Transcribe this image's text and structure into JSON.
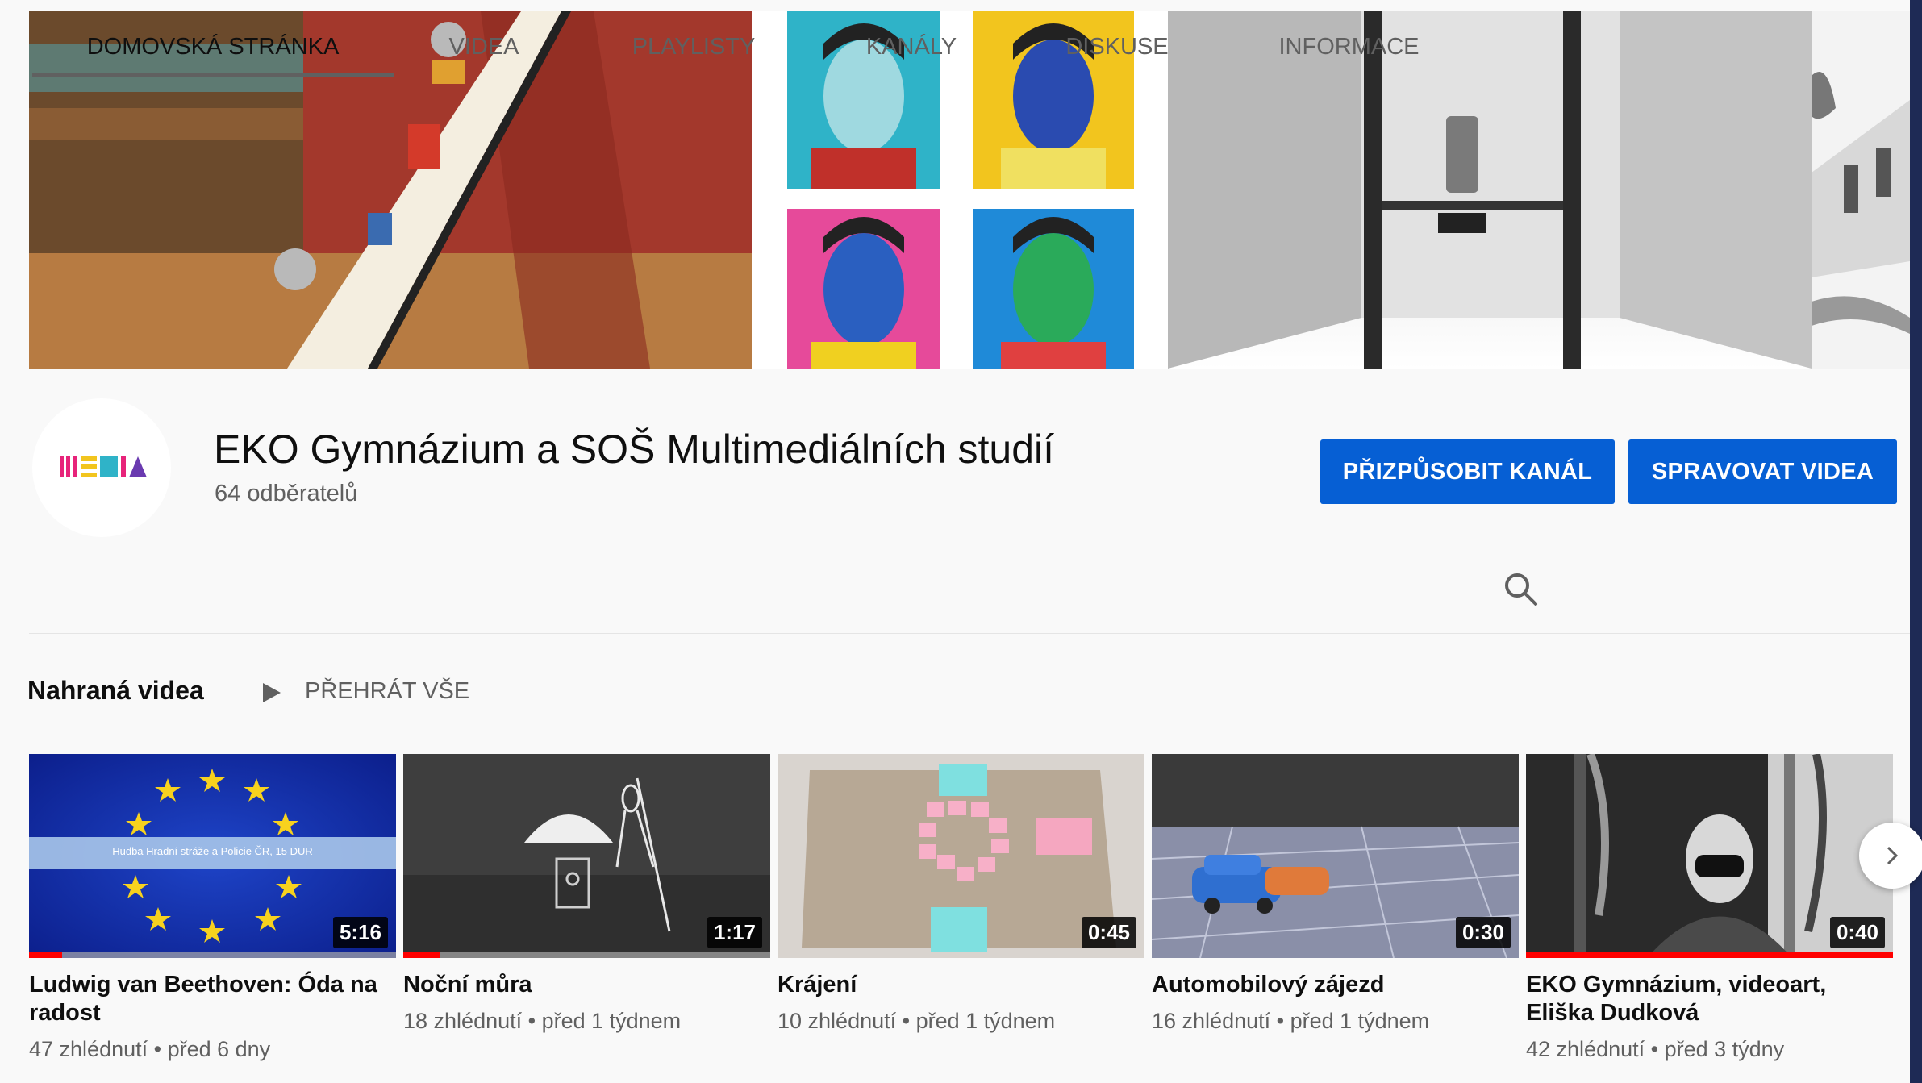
{
  "channel": {
    "name": "EKO Gymnázium a SOŠ Multimediálních studií",
    "subscribers": "64 odběratelů"
  },
  "buttons": {
    "customize": "PŘIZPŮSOBIT KANÁL",
    "manage": "SPRAVOVAT VIDEA"
  },
  "tabs": [
    {
      "label": "DOMOVSKÁ STRÁNKA",
      "active": true
    },
    {
      "label": "VIDEA",
      "active": false
    },
    {
      "label": "PLAYLISTY",
      "active": false
    },
    {
      "label": "KANÁLY",
      "active": false
    },
    {
      "label": "DISKUSE",
      "active": false
    },
    {
      "label": "INFORMACE",
      "active": false
    }
  ],
  "section": {
    "title": "Nahraná videa",
    "play_all": "PŘEHRÁT VŠE"
  },
  "videos": [
    {
      "title": "Ludwig van Beethoven: Óda na radost",
      "duration": "5:16",
      "views": "47 zhlédnutí",
      "age": "před 6 dny",
      "meta": "47 zhlédnutí • před 6 dny",
      "overlay_text": "Hudba Hradní stráže a Policie ČR, 15 DUR",
      "progress": 0.09
    },
    {
      "title": "Noční můra",
      "duration": "1:17",
      "meta": "18 zhlédnutí • před 1 týdnem",
      "progress": 0.1
    },
    {
      "title": "Krájení",
      "duration": "0:45",
      "meta": "10 zhlédnutí • před 1 týdnem",
      "progress": 0
    },
    {
      "title": "Automobilový zájezd",
      "duration": "0:30",
      "meta": "16 zhlédnutí • před 1 týdnem",
      "progress": 0
    },
    {
      "title": "EKO Gymnázium, videoart, Eliška Dudková",
      "duration": "0:40",
      "meta": "42 zhlédnutí • před 3 týdny",
      "progress": 1.0
    }
  ],
  "colors": {
    "primary_button": "#065fd4",
    "progress": "#ff0000"
  },
  "icons": {
    "search": "search-icon",
    "play": "play-icon",
    "next": "chevron-right-icon"
  }
}
